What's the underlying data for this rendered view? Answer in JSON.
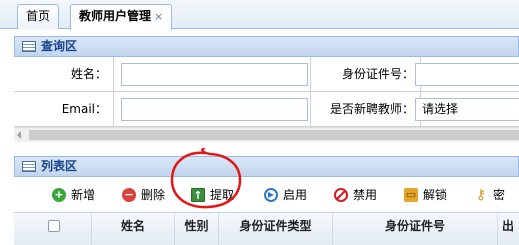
{
  "tabs": [
    {
      "label": "首页"
    },
    {
      "label": "教师用户管理",
      "close": "×"
    }
  ],
  "query_panel": {
    "title": "查询区",
    "fields": {
      "name_label": "姓名：",
      "name_value": "",
      "idcard_label": "身份证件号：",
      "idcard_value": "",
      "email_label": "Email：",
      "email_value": "",
      "newhire_label": "是否新聘教师：",
      "newhire_selected": "请选择"
    }
  },
  "list_panel": {
    "title": "列表区",
    "toolbar": {
      "add": "新增",
      "delete": "删除",
      "extract": "提取",
      "enable": "启用",
      "disable": "禁用",
      "unlock": "解锁",
      "password": "密"
    },
    "columns": [
      "姓名",
      "性别",
      "身份证件类型",
      "身份证件号",
      "出"
    ]
  },
  "colors": {
    "panel_header": "#c2d5ee",
    "panel_title": "#15428b",
    "annotation": "#e01818"
  },
  "icons": {
    "add": "plus-circle-icon",
    "delete": "minus-circle-icon",
    "extract": "upload-arrow-icon",
    "enable": "play-circle-icon",
    "disable": "ban-icon",
    "unlock": "lock-icon",
    "password": "key-icon"
  }
}
